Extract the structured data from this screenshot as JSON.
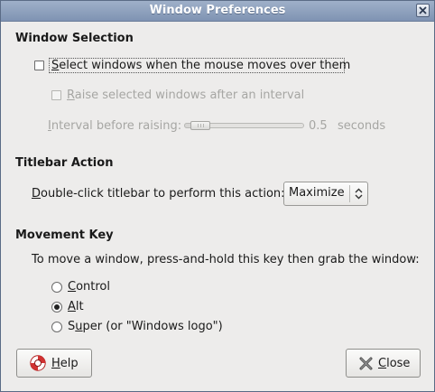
{
  "window": {
    "title": "Window Preferences"
  },
  "window_selection": {
    "heading": "Window Selection",
    "select_on_mouse": {
      "mnemonic": "S",
      "rest": "elect windows when the mouse moves over them",
      "checked": false
    },
    "raise_after_interval": {
      "mnemonic": "R",
      "rest": "aise selected windows after an interval",
      "checked": false,
      "enabled": false
    },
    "interval": {
      "mnemonic": "I",
      "rest": "nterval before raising:",
      "value": "0.5",
      "unit": "seconds",
      "level": 0.06,
      "enabled": false
    }
  },
  "titlebar_action": {
    "heading": "Titlebar Action",
    "label_mnemonic": "D",
    "label_rest": "ouble-click titlebar to perform this action:",
    "selected": "Maximize"
  },
  "movement_key": {
    "heading": "Movement Key",
    "description": "To move a window, press-and-hold this key then grab the window:",
    "options": [
      {
        "mnemonic": "C",
        "rest": "ontrol",
        "selected": false
      },
      {
        "mnemonic": "A",
        "rest": "lt",
        "selected": true
      },
      {
        "mnemonic": "u",
        "prefix": "S",
        "rest": "per (or \"Windows logo\")",
        "selected": false
      }
    ]
  },
  "buttons": {
    "help": {
      "mnemonic": "H",
      "rest": "elp"
    },
    "close": {
      "mnemonic": "C",
      "rest": "lose"
    }
  },
  "icons": {
    "help": "lifebuoy-icon",
    "close": "close-x-icon",
    "window_close": "close-icon",
    "combo_arrow": "chevron-updown-icon"
  }
}
